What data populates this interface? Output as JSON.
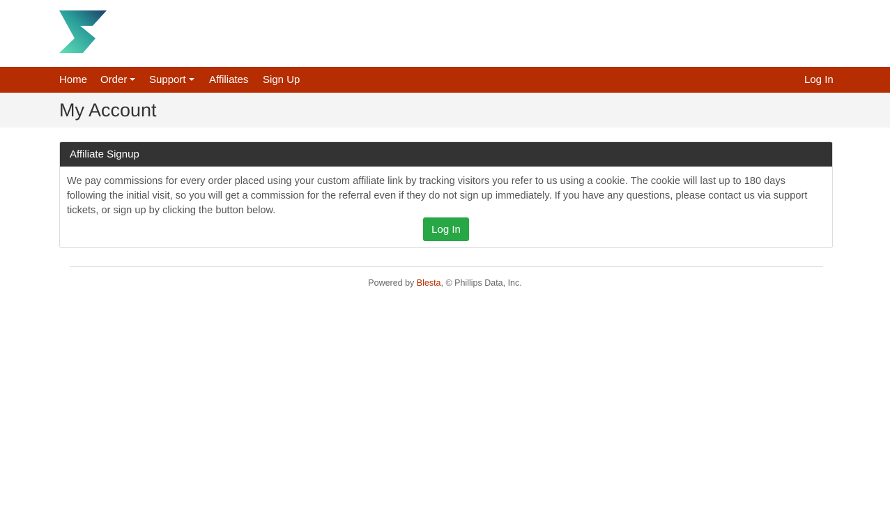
{
  "colors": {
    "brand": "#b52d01",
    "header_dark": "#333333",
    "button_green": "#28a745",
    "title_bg": "#f4f4f4"
  },
  "logo": {
    "icon": "s-logo-icon"
  },
  "nav": {
    "home": "Home",
    "order": "Order",
    "support": "Support",
    "affiliates": "Affiliates",
    "signup": "Sign Up",
    "login": "Log In"
  },
  "page": {
    "title": "My Account"
  },
  "card": {
    "title": "Affiliate Signup",
    "body": "We pay commissions for every order placed using your custom affiliate link by tracking visitors you refer to us using a cookie. The cookie will last up to 180 days following the initial visit, so you will get a commission for the referral even if they do not sign up immediately. If you have any questions, please contact us via support tickets, or sign up by clicking the button below.",
    "button": "Log In"
  },
  "footer": {
    "prefix": "Powered by ",
    "link": "Blesta",
    "suffix": ", © Phillips Data, Inc."
  }
}
